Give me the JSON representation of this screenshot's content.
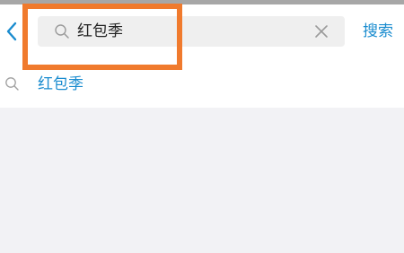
{
  "header": {
    "back_icon": "chevron-left-icon",
    "search_icon": "search-icon",
    "query": "红包季",
    "clear_icon": "close-icon",
    "submit_label": "搜索"
  },
  "suggestions": [
    {
      "icon": "search-icon",
      "label": "红包季"
    }
  ],
  "colors": {
    "accent": "#1a8ccf",
    "highlight": "#f07a2d",
    "top_strip": "#a7a7a7",
    "search_box_bg": "#efefef",
    "page_bg": "#f2f2f5"
  }
}
